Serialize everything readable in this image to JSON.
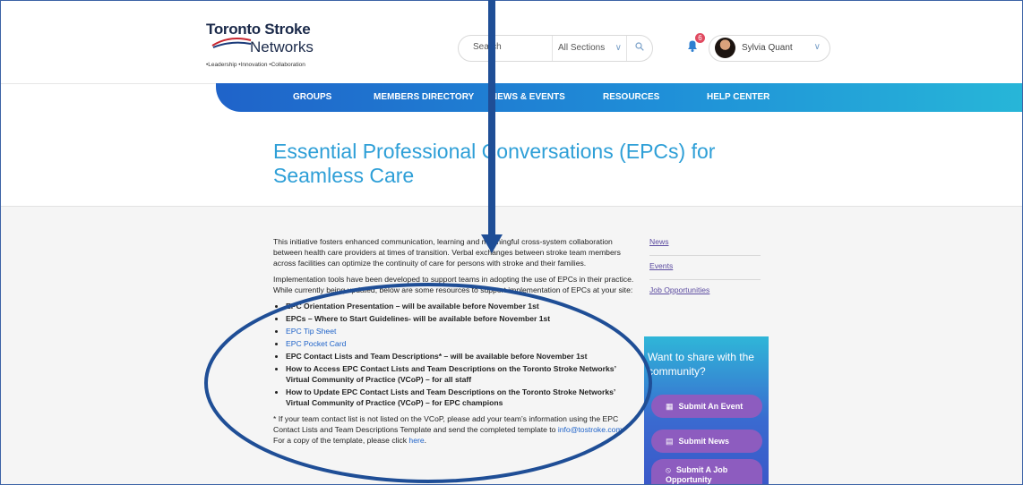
{
  "brand": {
    "name_line1": "Toronto Stroke",
    "name_line2": "Networks",
    "tagline": "•Leadership  •Innovation  •Collaboration"
  },
  "search": {
    "placeholder": "Search",
    "section": "All Sections"
  },
  "notifications": {
    "count": "6"
  },
  "user": {
    "name": "Sylvia Quant"
  },
  "nav": {
    "items": [
      {
        "label": "GROUPS"
      },
      {
        "label": "MEMBERS DIRECTORY"
      },
      {
        "label": "NEWS & EVENTS"
      },
      {
        "label": "RESOURCES"
      },
      {
        "label": "HELP CENTER"
      }
    ]
  },
  "page": {
    "title": "Essential Professional Conversations (EPCs) for Seamless Care"
  },
  "content": {
    "para1": "This initiative fosters enhanced communication, learning and meaningful cross-system collaboration between health care providers at times of transition. Verbal exchanges between stroke team members across facilities can optimize the continuity of care for persons with stroke and their families.",
    "para2": "Implementation tools have been developed to support teams in adopting the use of EPCs in their practice.  While currently being updated, below are some resources to support implementation of EPCs at your site:",
    "list": [
      {
        "text": "EPC Orientation Presentation – will be available before November 1st",
        "type": "bold"
      },
      {
        "text": "EPCs – Where to Start Guidelines- will be available before November 1st",
        "type": "bold"
      },
      {
        "text": "EPC Tip Sheet",
        "type": "link"
      },
      {
        "text": "EPC Pocket Card",
        "type": "link"
      },
      {
        "text": "EPC Contact Lists and Team Descriptions* – will be available before November 1st",
        "type": "bold"
      },
      {
        "text": "How to Access EPC Contact Lists and Team Descriptions on the Toronto Stroke Networks’ Virtual Community of Practice (VCoP) – for all staff",
        "type": "bold"
      },
      {
        "text": "How to Update EPC Contact Lists and Team Descriptions on the Toronto Stroke Networks’ Virtual Community of Practice (VCoP) – for EPC champions",
        "type": "bold"
      }
    ],
    "footnote_before": "* If your team contact list is not listed on the VCoP, please add your team’s information using the EPC Contact Lists and Team Descriptions Template and send the completed template to ",
    "footnote_email": "info@tostroke.com",
    "footnote_middle": ".  For a copy of the template, please click ",
    "footnote_link": "here",
    "footnote_end": "."
  },
  "sidebar": {
    "links": [
      {
        "label": "News"
      },
      {
        "label": "Events"
      },
      {
        "label": "Job Opportunities"
      }
    ],
    "share_heading": "Want to share with the community?",
    "buttons": [
      {
        "label": "Submit An Event",
        "icon": "calendar-icon"
      },
      {
        "label": "Submit News",
        "icon": "news-icon"
      },
      {
        "label": "Submit A Job Opportunity",
        "icon": "paperclip-icon"
      }
    ]
  },
  "colors": {
    "accent": "#2e9fd7",
    "nav_start": "#1f63c9",
    "nav_end": "#27b6d8",
    "button": "#8d5cbf",
    "annotation": "#1f4e96"
  }
}
